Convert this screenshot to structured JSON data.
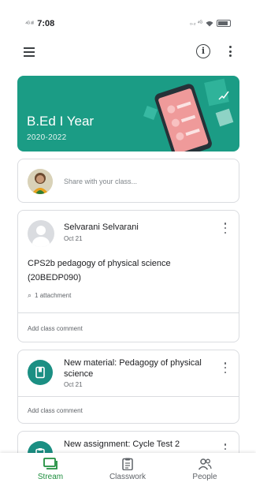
{
  "status_bar": {
    "time": "7:08",
    "left_signal": "⁴ᴳ ᵃˡˡ",
    "right_indicators": "₀.₂ ⁴ᴳ"
  },
  "app_bar": {
    "menu_icon": "menu-icon",
    "info_icon": "info-icon",
    "more_icon": "more-vert-icon"
  },
  "banner": {
    "title": "B.Ed I Year",
    "subtitle": "2020-2022",
    "color": "#1b9c85"
  },
  "share": {
    "placeholder": "Share with your class..."
  },
  "posts": [
    {
      "author": "Selvarani Selvarani",
      "date": "Oct 21",
      "body": "CPS2b pedagogy of physical science (20BEDP090)",
      "attachment": "1 attachment",
      "comment": "Add class comment"
    }
  ],
  "material": {
    "title": "New material: Pedagogy of physical science",
    "date": "Oct 21",
    "comment": "Add class comment",
    "icon": "book-icon"
  },
  "assignment": {
    "title": "New assignment: Cycle Test 2",
    "icon": "assignment-icon"
  },
  "bottom_nav": {
    "items": [
      {
        "label": "Stream",
        "icon": "stream-icon",
        "active": true
      },
      {
        "label": "Classwork",
        "icon": "classwork-icon",
        "active": false
      },
      {
        "label": "People",
        "icon": "people-icon",
        "active": false
      }
    ],
    "active_color": "#1e8e3e"
  }
}
